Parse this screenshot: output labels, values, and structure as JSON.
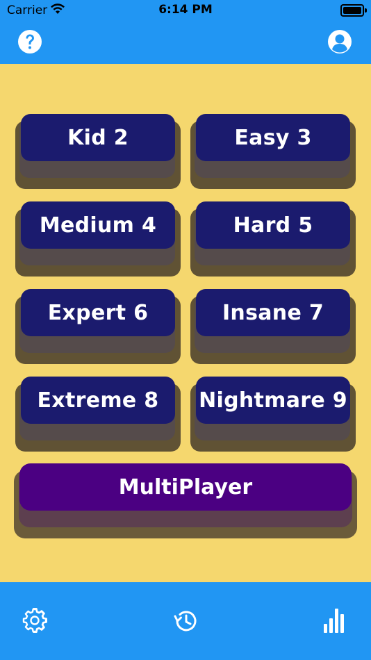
{
  "status_bar": {
    "carrier": "Carrier",
    "time": "6:14 PM"
  },
  "levels": [
    {
      "label": "Kid 2"
    },
    {
      "label": "Easy 3"
    },
    {
      "label": "Medium 4"
    },
    {
      "label": "Hard 5"
    },
    {
      "label": "Expert 6"
    },
    {
      "label": "Insane 7"
    },
    {
      "label": "Extreme 8"
    },
    {
      "label": "Nightmare 9"
    }
  ],
  "multiplayer": {
    "label": "MultiPlayer"
  },
  "icons": {
    "help": "question-circle-icon",
    "profile": "user-circle-icon",
    "settings": "gear-icon",
    "history": "history-icon",
    "stats": "bar-chart-icon"
  },
  "colors": {
    "header": "#2196f3",
    "background": "#f5d76e",
    "level_button": "#1b1b6e",
    "multiplayer_button": "#4b0082"
  }
}
